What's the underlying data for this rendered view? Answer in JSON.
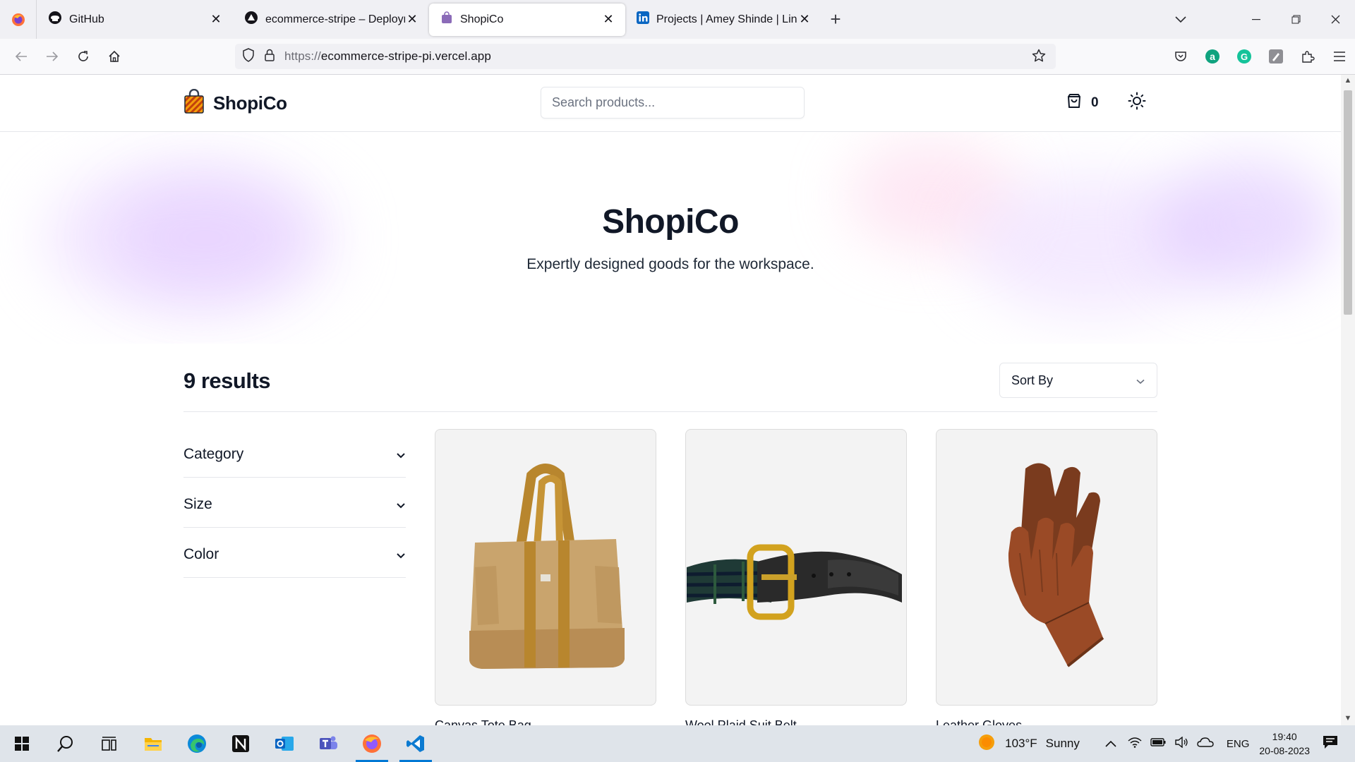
{
  "browser": {
    "tabs": [
      {
        "title": "GitHub",
        "icon": "github-icon"
      },
      {
        "title": "ecommerce-stripe – Deployments",
        "icon": "vercel-icon"
      },
      {
        "title": "ShopiCo",
        "icon": "shopping-bag-icon",
        "active": true
      },
      {
        "title": "Projects | Amey Shinde | LinkedIn",
        "icon": "linkedin-icon"
      }
    ],
    "url_protocol": "https://",
    "url_host": "ecommerce-stripe-pi.vercel.app"
  },
  "site": {
    "brand": "ShopiCo",
    "search_placeholder": "Search products...",
    "cart_count": "0"
  },
  "hero": {
    "title": "ShopiCo",
    "subtitle": "Expertly designed goods for the workspace."
  },
  "results": {
    "count_label": "9 results",
    "sort_label": "Sort By"
  },
  "filters": [
    {
      "label": "Category"
    },
    {
      "label": "Size"
    },
    {
      "label": "Color"
    }
  ],
  "products": [
    {
      "name": "Canvas Tote Bag",
      "image": "tote-bag"
    },
    {
      "name": "Wool Plaid Suit Belt",
      "image": "belt"
    },
    {
      "name": "Leather Gloves",
      "image": "gloves"
    }
  ],
  "taskbar": {
    "weather_temp": "103°F",
    "weather_text": "Sunny",
    "language": "ENG",
    "time": "19:40",
    "date": "20-08-2023"
  },
  "colors": {
    "accent": "#0078d4",
    "text": "#111827",
    "border": "#e5e7eb"
  }
}
